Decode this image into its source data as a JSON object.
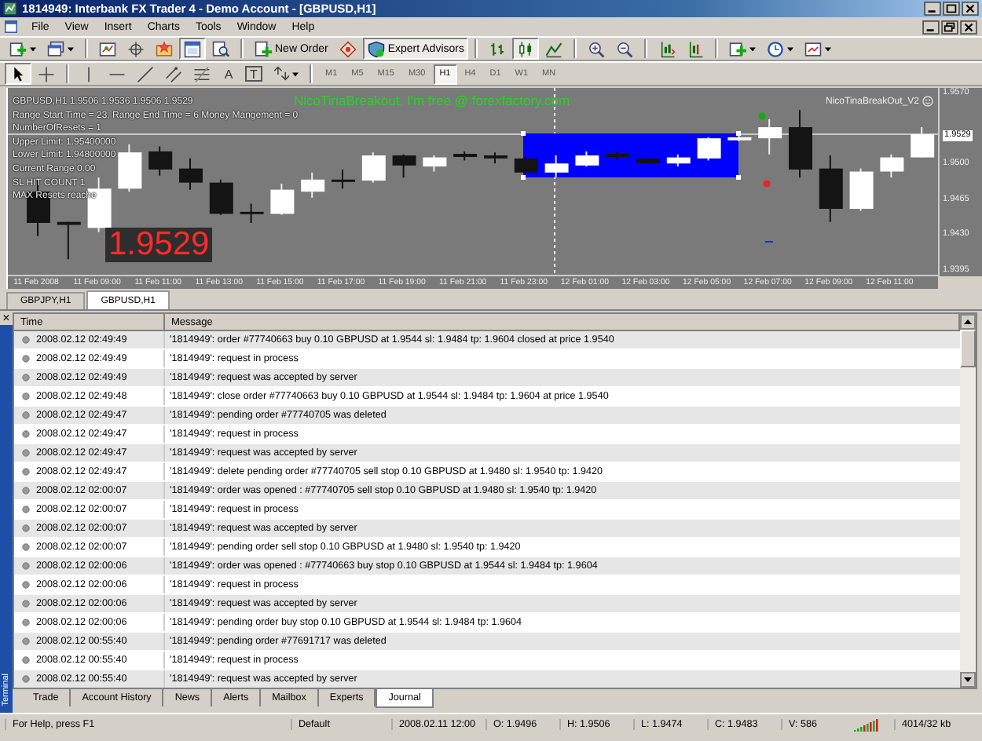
{
  "window": {
    "title": "1814949: Interbank FX Trader 4 - Demo Account - [GBPUSD,H1]"
  },
  "menu": [
    "File",
    "View",
    "Insert",
    "Charts",
    "Tools",
    "Window",
    "Help"
  ],
  "toolbar": [
    {
      "kind": "new-chart",
      "pressed": false
    },
    {
      "kind": "profiles",
      "pressed": false
    },
    {
      "kind": "sep"
    },
    {
      "kind": "market-watch",
      "pressed": false
    },
    {
      "kind": "data-window",
      "pressed": false
    },
    {
      "kind": "navigator",
      "pressed": false
    },
    {
      "kind": "terminal",
      "pressed": true
    },
    {
      "kind": "tester",
      "pressed": false
    },
    {
      "kind": "sep"
    },
    {
      "kind": "new-order",
      "label": "New Order",
      "pressed": false
    },
    {
      "kind": "autotrade",
      "pressed": false
    },
    {
      "kind": "expert-advisors",
      "label": "Expert Advisors",
      "pressed": true
    },
    {
      "kind": "sep"
    },
    {
      "kind": "bar-chart",
      "pressed": false
    },
    {
      "kind": "candles",
      "pressed": true
    },
    {
      "kind": "line-chart",
      "pressed": false
    },
    {
      "kind": "sep"
    },
    {
      "kind": "zoom-in",
      "pressed": false
    },
    {
      "kind": "zoom-out",
      "pressed": false
    },
    {
      "kind": "sep"
    },
    {
      "kind": "autoscroll",
      "pressed": false
    },
    {
      "kind": "shift",
      "pressed": false
    },
    {
      "kind": "sep"
    },
    {
      "kind": "indicators",
      "pressed": false
    },
    {
      "kind": "periods",
      "pressed": false
    },
    {
      "kind": "templates",
      "pressed": false
    }
  ],
  "drawing_tools": [
    {
      "kind": "cursor",
      "selected": true
    },
    {
      "kind": "crosshair",
      "selected": false
    },
    {
      "kind": "sep"
    },
    {
      "kind": "vline",
      "selected": false
    },
    {
      "kind": "hline",
      "selected": false
    },
    {
      "kind": "trend",
      "selected": false
    },
    {
      "kind": "channel",
      "selected": false
    },
    {
      "kind": "fibo",
      "selected": false
    },
    {
      "kind": "text",
      "label": "A",
      "selected": false
    },
    {
      "kind": "label",
      "label": "T",
      "selected": false
    },
    {
      "kind": "arrows",
      "selected": false
    }
  ],
  "timeframes": [
    {
      "label": "M1",
      "selected": false
    },
    {
      "label": "M5",
      "selected": false
    },
    {
      "label": "M15",
      "selected": false
    },
    {
      "label": "M30",
      "selected": false
    },
    {
      "label": "H1",
      "selected": true
    },
    {
      "label": "H4",
      "selected": false
    },
    {
      "label": "D1",
      "selected": false
    },
    {
      "label": "W1",
      "selected": false
    },
    {
      "label": "MN",
      "selected": false
    }
  ],
  "chart": {
    "info_lines": [
      "GBPUSD,H1  1.9506 1.9536 1.9506 1.9529",
      "Range Start Time = 23,  Range End Time = 6  Money Mangement = 0",
      "NumberOfResets = 1",
      "Upper Limit: 1.95400000",
      "Lower Limit: 1.94800000",
      "Current Range 0.00",
      "SL HIT COUNT 1",
      "MAX Resets reache"
    ],
    "ea_banner": "NicoTinaBreakout, I'm free @ forexfactory.com",
    "ea_name": "NicoTinaBreakOut_V2",
    "big_price": "1.9529",
    "current_price": "1.9529",
    "chart_data": {
      "type": "candlestick",
      "categories": [
        "11 Feb 2008",
        null,
        "11 Feb 09:00",
        null,
        "11 Feb 11:00",
        null,
        "11 Feb 13:00",
        null,
        "11 Feb 15:00",
        null,
        "11 Feb 17:00",
        null,
        "11 Feb 19:00",
        null,
        "11 Feb 21:00",
        null,
        "11 Feb 23:00",
        null,
        "12 Feb 01:00",
        null,
        "12 Feb 03:00",
        null,
        "12 Feb 05:00",
        null,
        "12 Feb 07:00",
        null,
        "12 Feb 09:00",
        null,
        "12 Feb 11:00",
        null
      ],
      "ylim": [
        1.9388,
        1.9575
      ],
      "ref_lines": [
        {
          "axis": "y",
          "value": 1.9529
        }
      ],
      "ohlc": [
        [
          1.9472,
          1.9483,
          1.9428,
          1.9441
        ],
        [
          1.9442,
          1.9442,
          1.9405,
          1.9439
        ],
        [
          1.9436,
          1.9486,
          1.9432,
          1.9475
        ],
        [
          1.9475,
          1.9519,
          1.9472,
          1.9511
        ],
        [
          1.9512,
          1.9517,
          1.9488,
          1.9494
        ],
        [
          1.9495,
          1.9505,
          1.9474,
          1.9481
        ],
        [
          1.9481,
          1.9484,
          1.9449,
          1.945
        ],
        [
          1.9452,
          1.946,
          1.9441,
          1.945
        ],
        [
          1.945,
          1.948,
          1.9449,
          1.9474
        ],
        [
          1.9472,
          1.9491,
          1.9466,
          1.9484
        ],
        [
          1.9484,
          1.9494,
          1.9475,
          1.9483
        ],
        [
          1.9483,
          1.9511,
          1.9481,
          1.9508
        ],
        [
          1.9508,
          1.9509,
          1.9486,
          1.9498
        ],
        [
          1.9497,
          1.9508,
          1.9492,
          1.9506
        ],
        [
          1.9508,
          1.9512,
          1.9503,
          1.9508
        ],
        [
          1.9508,
          1.9511,
          1.95,
          1.9505
        ],
        [
          1.9505,
          1.9506,
          1.9489,
          1.9491
        ],
        [
          1.9491,
          1.9508,
          1.9486,
          1.95
        ],
        [
          1.9498,
          1.9512,
          1.9497,
          1.9508
        ],
        [
          1.9508,
          1.9512,
          1.9503,
          1.9508
        ],
        [
          1.9505,
          1.9505,
          1.95,
          1.95
        ],
        [
          1.95,
          1.9509,
          1.9497,
          1.9506
        ],
        [
          1.9505,
          1.9526,
          1.9503,
          1.9525
        ],
        [
          1.9523,
          1.953,
          1.9522,
          1.9526
        ],
        [
          1.9525,
          1.9544,
          1.9509,
          1.9536
        ],
        [
          1.9536,
          1.9553,
          1.9486,
          1.9494
        ],
        [
          1.9495,
          1.9508,
          1.9442,
          1.9455
        ],
        [
          1.9455,
          1.9495,
          1.9453,
          1.9492
        ],
        [
          1.9492,
          1.9509,
          1.9486,
          1.9506
        ],
        [
          1.9506,
          1.9536,
          1.9506,
          1.9529
        ]
      ],
      "yticks": [
        {
          "value": 1.957,
          "label": "1.9570"
        },
        {
          "value": 1.95,
          "label": "1.9500"
        },
        {
          "value": 1.9465,
          "label": "1.9465"
        },
        {
          "value": 1.943,
          "label": "1.9430"
        },
        {
          "value": 1.9395,
          "label": "1.9395"
        }
      ]
    }
  },
  "chart_tabs": [
    {
      "label": "GBPJPY,H1",
      "selected": false
    },
    {
      "label": "GBPUSD,H1",
      "selected": true
    }
  ],
  "terminal": {
    "title": "Terminal",
    "close": "×",
    "columns": [
      "Time",
      "Message"
    ],
    "rows": [
      {
        "time": "2008.02.12 02:49:49",
        "message": "'1814949': order #77740663 buy 0.10 GBPUSD at 1.9544 sl: 1.9484 tp: 1.9604 closed at price 1.9540"
      },
      {
        "time": "2008.02.12 02:49:49",
        "message": "'1814949': request in process"
      },
      {
        "time": "2008.02.12 02:49:49",
        "message": "'1814949': request was accepted by server"
      },
      {
        "time": "2008.02.12 02:49:48",
        "message": "'1814949': close order #77740663 buy 0.10 GBPUSD at 1.9544 sl: 1.9484 tp: 1.9604 at price 1.9540"
      },
      {
        "time": "2008.02.12 02:49:47",
        "message": "'1814949': pending order #77740705 was deleted"
      },
      {
        "time": "2008.02.12 02:49:47",
        "message": "'1814949': request in process"
      },
      {
        "time": "2008.02.12 02:49:47",
        "message": "'1814949': request was accepted by server"
      },
      {
        "time": "2008.02.12 02:49:47",
        "message": "'1814949': delete pending order #77740705 sell stop 0.10 GBPUSD at 1.9480 sl: 1.9540 tp: 1.9420"
      },
      {
        "time": "2008.02.12 02:00:07",
        "message": "'1814949': order was opened : #77740705 sell stop 0.10 GBPUSD at 1.9480 sl: 1.9540 tp: 1.9420"
      },
      {
        "time": "2008.02.12 02:00:07",
        "message": "'1814949': request in process"
      },
      {
        "time": "2008.02.12 02:00:07",
        "message": "'1814949': request was accepted by server"
      },
      {
        "time": "2008.02.12 02:00:07",
        "message": "'1814949': pending order sell stop 0.10 GBPUSD at 1.9480 sl: 1.9540 tp: 1.9420"
      },
      {
        "time": "2008.02.12 02:00:06",
        "message": "'1814949': order was opened : #77740663 buy stop 0.10 GBPUSD at 1.9544 sl: 1.9484 tp: 1.9604"
      },
      {
        "time": "2008.02.12 02:00:06",
        "message": "'1814949': request in process"
      },
      {
        "time": "2008.02.12 02:00:06",
        "message": "'1814949': request was accepted by server"
      },
      {
        "time": "2008.02.12 02:00:06",
        "message": "'1814949': pending order buy stop 0.10 GBPUSD at 1.9544 sl: 1.9484 tp: 1.9604"
      },
      {
        "time": "2008.02.12 00:55:40",
        "message": "'1814949': pending order #77691717 was deleted"
      },
      {
        "time": "2008.02.12 00:55:40",
        "message": "'1814949': request in process"
      },
      {
        "time": "2008.02.12 00:55:40",
        "message": "'1814949': request was accepted by server"
      }
    ],
    "tabs": [
      {
        "label": "Trade",
        "selected": false
      },
      {
        "label": "Account History",
        "selected": false
      },
      {
        "label": "News",
        "selected": false
      },
      {
        "label": "Alerts",
        "selected": false
      },
      {
        "label": "Mailbox",
        "selected": false
      },
      {
        "label": "Experts",
        "selected": false
      },
      {
        "label": "Journal",
        "selected": true
      }
    ]
  },
  "status_bar": {
    "help": "For Help, press F1",
    "profile": "Default",
    "time": "2008.02.11 12:00",
    "open": "O: 1.9496",
    "high": "H: 1.9506",
    "low": "L: 1.9474",
    "close": "C: 1.9483",
    "volume": "V: 586",
    "traffic": "4014/32 kb"
  }
}
